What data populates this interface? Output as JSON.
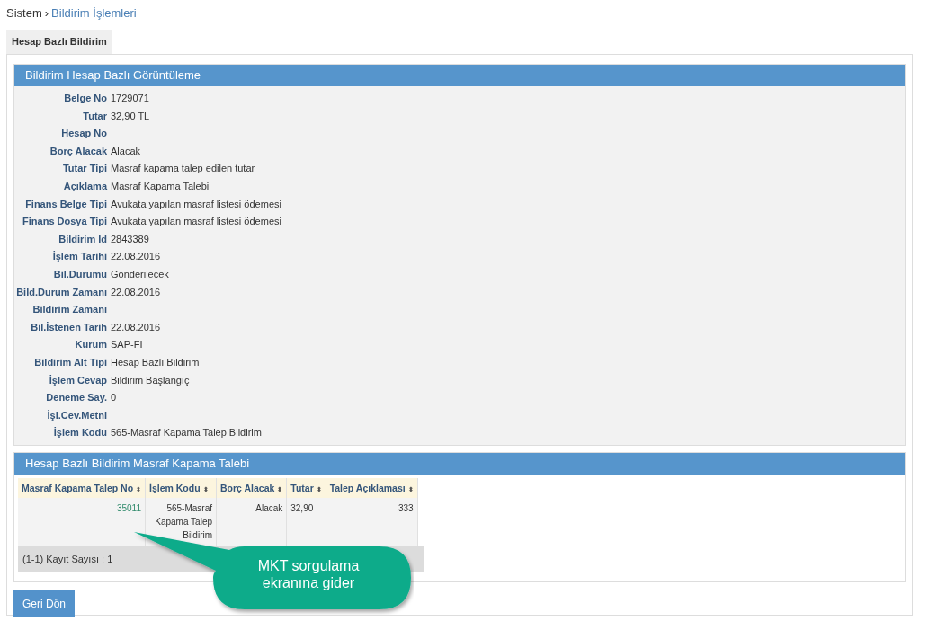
{
  "breadcrumb": {
    "root": "Sistem",
    "separator": "›",
    "current": "Bildirim İşlemleri"
  },
  "tabs": [
    {
      "label": "Hesap Bazlı Bildirim",
      "selected": true
    }
  ],
  "detail_panel": {
    "title": "Bildirim Hesap Bazlı Görüntüleme",
    "fields": [
      {
        "label": "Belge No",
        "value": "1729071"
      },
      {
        "label": "Tutar",
        "value": "32,90 TL"
      },
      {
        "label": "Hesap No"
      },
      {
        "label": "Borç Alacak",
        "value": "Alacak"
      },
      {
        "label": "Tutar Tipi",
        "value": "Masraf kapama talep edilen tutar"
      },
      {
        "label": "Açıklama",
        "value": "Masraf Kapama Talebi"
      },
      {
        "label": "Finans Belge Tipi",
        "value": "Avukata yapılan masraf listesi ödemesi"
      },
      {
        "label": "Finans Dosya Tipi",
        "value": "Avukata yapılan masraf listesi ödemesi"
      },
      {
        "label": "Bildirim Id",
        "value": "2843389"
      },
      {
        "label": "İşlem Tarihi",
        "value": "22.08.2016"
      },
      {
        "label": "Bil.Durumu",
        "value": "Gönderilecek"
      },
      {
        "label": "Bild.Durum Zamanı",
        "value": "22.08.2016"
      },
      {
        "label": "Bildirim Zamanı"
      },
      {
        "label": "Bil.İstenen Tarih",
        "value": "22.08.2016"
      },
      {
        "label": "Kurum",
        "value": "SAP-FI"
      },
      {
        "label": "Bildirim Alt Tipi",
        "value": "Hesap Bazlı Bildirim"
      },
      {
        "label": "İşlem Cevap",
        "value": "Bildirim Başlangıç"
      },
      {
        "label": "Deneme Say.",
        "value": "0"
      },
      {
        "label": "İşl.Cev.Metni"
      },
      {
        "label": "İşlem Kodu",
        "value": "565-Masraf Kapama Talep Bildirim"
      }
    ]
  },
  "table_panel": {
    "title": "Hesap Bazlı Bildirim Masraf Kapama Talebi",
    "columns": [
      {
        "label": "Masraf Kapama Talep No",
        "sort": "⬍"
      },
      {
        "label": "İşlem Kodu",
        "sort": "⬍"
      },
      {
        "label": "Borç Alacak",
        "sort": "⬍"
      },
      {
        "label": "Tutar",
        "sort": "⬍"
      },
      {
        "label": "Talep Açıklaması",
        "sort": "⬍"
      }
    ],
    "rows": [
      {
        "cells": [
          {
            "text": "35011",
            "kind": "link"
          },
          {
            "text": "565-Masraf Kapama Talep Bildirim",
            "kind": "right"
          },
          {
            "text": "Alacak",
            "kind": "right"
          },
          {
            "text": "32,90",
            "kind": "left"
          },
          {
            "text": "333",
            "kind": "right"
          }
        ]
      }
    ],
    "footer": "(1-1) Kayıt Sayısı : 1"
  },
  "back_button": "Geri Dön",
  "callout": "MKT sorgulama ekranına gider"
}
